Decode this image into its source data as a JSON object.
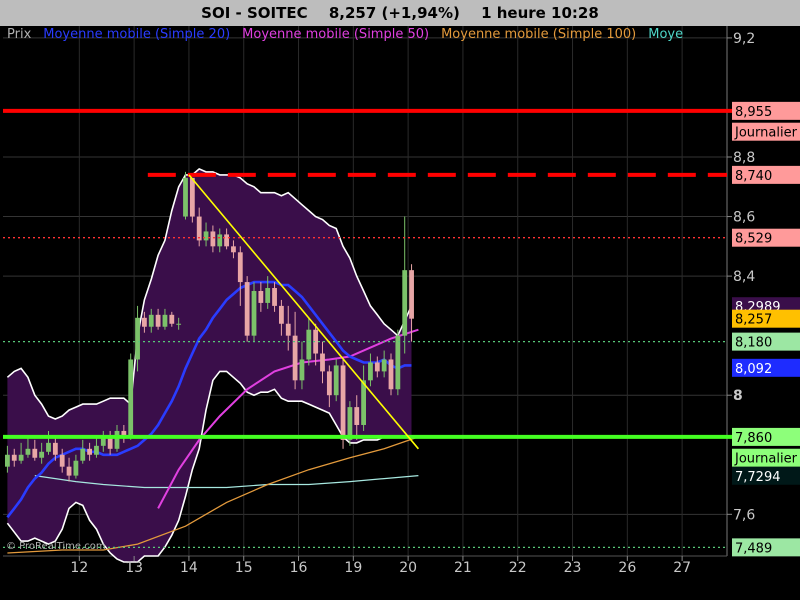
{
  "header": {
    "symbol": "SOI - SOITEC",
    "price_change": "8,257 (+1,94%)",
    "period_time": "1 heure  10:28"
  },
  "legend": [
    {
      "label": "Prix",
      "color": "#b0b0b0"
    },
    {
      "label": "Moyenne mobile (Simple 20)",
      "color": "#2a3cff"
    },
    {
      "label": "Moyenne mobile (Simple 50)",
      "color": "#e040e0"
    },
    {
      "label": "Moyenne mobile (Simple 100)",
      "color": "#e39a3c"
    },
    {
      "label": "Moye",
      "color": "#4fd6c8"
    }
  ],
  "watermark": "© ProRealTime.com",
  "colors": {
    "background": "#000000",
    "bollinger_fill": "#3a0e4a",
    "bollinger_border": "#ffffff",
    "candle_up": "#7cc26a",
    "candle_down": "#e8a6a6",
    "ma20": "#2a3cff",
    "ma50": "#e040e0",
    "ma100": "#e39a3c",
    "ma200": "#a7e8e0",
    "trendline": "#ffff00",
    "resistance": "#ff0000",
    "support": "#44ff22"
  },
  "chart_data": {
    "type": "candlestick",
    "x_tick_labels": [
      "12",
      "13",
      "14",
      "15",
      "16",
      "19",
      "20",
      "21",
      "22",
      "23",
      "26",
      "27"
    ],
    "y_tick_labels": [
      "7,6",
      "8",
      "8,4",
      "8,6",
      "8,8",
      "9,2"
    ],
    "ylim": [
      7.46,
      9.24
    ],
    "price_tags": [
      {
        "text": "8,955",
        "value": 8.955,
        "bg": "#ff9a9a",
        "fg": "#000000"
      },
      {
        "text": "Journalier",
        "value": 8.885,
        "bg": "#ff9a9a",
        "fg": "#000000"
      },
      {
        "text": "8,740",
        "value": 8.74,
        "bg": "#ff9a9a",
        "fg": "#000000"
      },
      {
        "text": "8,529",
        "value": 8.529,
        "bg": "#ff9a9a",
        "fg": "#000000"
      },
      {
        "text": "8,2989",
        "value": 8.2989,
        "bg": "#3a0e4a",
        "fg": "#ffffff"
      },
      {
        "text": "8,257",
        "value": 8.257,
        "bg": "#ffc000",
        "fg": "#000000"
      },
      {
        "text": "8,180",
        "value": 8.18,
        "bg": "#9ce7a3",
        "fg": "#000000"
      },
      {
        "text": "8,092",
        "value": 8.092,
        "bg": "#1e2cff",
        "fg": "#ffffff"
      },
      {
        "text": "7,860",
        "value": 7.86,
        "bg": "#8dff7a",
        "fg": "#000000"
      },
      {
        "text": "Journalier",
        "value": 7.79,
        "bg": "#8dff7a",
        "fg": "#000000"
      },
      {
        "text": "7,7294",
        "value": 7.7294,
        "bg": "#001818",
        "fg": "#ffffff"
      },
      {
        "text": "7,489",
        "value": 7.489,
        "bg": "#9ce7a3",
        "fg": "#000000"
      }
    ],
    "levels": [
      {
        "value": 8.955,
        "color": "#ff0000",
        "style": "solid",
        "width": 4
      },
      {
        "value": 8.74,
        "color": "#ff0000",
        "style": "dashed-long",
        "width": 4,
        "from_index": 20.5
      },
      {
        "value": 8.529,
        "color": "#ff3333",
        "style": "dotted",
        "width": 1.3
      },
      {
        "value": 8.18,
        "color": "#58c878",
        "style": "dotted",
        "width": 1.3
      },
      {
        "value": 7.86,
        "color": "#44ff22",
        "style": "solid",
        "width": 4
      },
      {
        "value": 7.489,
        "color": "#58c878",
        "style": "dotted",
        "width": 1.3
      }
    ],
    "trendline": {
      "from": [
        26.5,
        8.74
      ],
      "to": [
        60,
        7.82
      ]
    },
    "bollinger_upper": [
      8.06,
      8.08,
      8.09,
      8.06,
      8.0,
      7.97,
      7.93,
      7.92,
      7.93,
      7.95,
      7.96,
      7.97,
      7.97,
      7.97,
      7.98,
      7.99,
      7.99,
      7.99,
      7.97,
      8.2,
      8.32,
      8.39,
      8.47,
      8.52,
      8.62,
      8.7,
      8.74,
      8.74,
      8.76,
      8.75,
      8.75,
      8.74,
      8.74,
      8.74,
      8.73,
      8.71,
      8.7,
      8.68,
      8.68,
      8.68,
      8.67,
      8.68,
      8.66,
      8.64,
      8.62,
      8.6,
      8.59,
      8.57,
      8.56,
      8.5,
      8.46,
      8.4,
      8.35,
      8.3,
      8.27,
      8.24,
      8.22,
      8.2,
      8.25,
      8.3
    ],
    "bollinger_lower": [
      7.57,
      7.54,
      7.51,
      7.51,
      7.52,
      7.51,
      7.5,
      7.51,
      7.55,
      7.62,
      7.64,
      7.63,
      7.58,
      7.55,
      7.5,
      7.47,
      7.45,
      7.44,
      7.44,
      7.44,
      7.46,
      7.46,
      7.46,
      7.49,
      7.53,
      7.58,
      7.66,
      7.75,
      7.82,
      7.95,
      8.05,
      8.08,
      8.08,
      8.06,
      8.04,
      8.01,
      8.0,
      8.01,
      8.01,
      8.02,
      7.99,
      7.98,
      7.98,
      7.98,
      7.97,
      7.96,
      7.95,
      7.94,
      7.9,
      7.86,
      7.84,
      7.84,
      7.85,
      7.85,
      7.85,
      7.86,
      7.86,
      7.86,
      7.86,
      7.86
    ],
    "ma20": [
      7.59,
      7.62,
      7.65,
      7.69,
      7.72,
      7.74,
      7.77,
      7.79,
      7.8,
      7.81,
      7.82,
      7.82,
      7.81,
      7.81,
      7.8,
      7.8,
      7.8,
      7.81,
      7.82,
      7.83,
      7.85,
      7.87,
      7.9,
      7.94,
      7.98,
      8.03,
      8.09,
      8.14,
      8.19,
      8.22,
      8.26,
      8.29,
      8.32,
      8.34,
      8.36,
      8.37,
      8.38,
      8.38,
      8.38,
      8.38,
      8.37,
      8.37,
      8.35,
      8.33,
      8.3,
      8.27,
      8.24,
      8.21,
      8.18,
      8.15,
      8.13,
      8.12,
      8.11,
      8.11,
      8.11,
      8.12,
      8.1,
      8.09,
      8.1,
      8.1
    ],
    "ma50_points": [
      [
        22,
        7.62
      ],
      [
        25,
        7.75
      ],
      [
        28,
        7.85
      ],
      [
        31,
        7.93
      ],
      [
        35,
        8.02
      ],
      [
        39,
        8.08
      ],
      [
        43,
        8.11
      ],
      [
        47,
        8.12
      ],
      [
        50,
        8.13
      ],
      [
        53,
        8.16
      ],
      [
        56,
        8.19
      ],
      [
        60,
        8.22
      ]
    ],
    "ma100_points": [
      [
        0,
        7.47
      ],
      [
        8,
        7.48
      ],
      [
        14,
        7.48
      ],
      [
        19,
        7.5
      ],
      [
        26,
        7.56
      ],
      [
        32,
        7.64
      ],
      [
        38,
        7.7
      ],
      [
        44,
        7.75
      ],
      [
        50,
        7.79
      ],
      [
        55,
        7.82
      ],
      [
        60,
        7.86
      ]
    ],
    "ma200_points": [
      [
        4,
        7.73
      ],
      [
        10,
        7.71
      ],
      [
        14,
        7.7
      ],
      [
        20,
        7.69
      ],
      [
        26,
        7.69
      ],
      [
        32,
        7.69
      ],
      [
        38,
        7.7
      ],
      [
        44,
        7.7
      ],
      [
        50,
        7.71
      ],
      [
        55,
        7.72
      ],
      [
        60,
        7.73
      ]
    ],
    "candles": [
      [
        7.76,
        7.8,
        7.83,
        7.74
      ],
      [
        7.8,
        7.78,
        7.82,
        7.76
      ],
      [
        7.78,
        7.8,
        7.84,
        7.77
      ],
      [
        7.8,
        7.82,
        7.86,
        7.79
      ],
      [
        7.82,
        7.79,
        7.85,
        7.78
      ],
      [
        7.79,
        7.81,
        7.84,
        7.77
      ],
      [
        7.81,
        7.84,
        7.88,
        7.8
      ],
      [
        7.84,
        7.8,
        7.86,
        7.78
      ],
      [
        7.8,
        7.76,
        7.82,
        7.74
      ],
      [
        7.76,
        7.73,
        7.79,
        7.71
      ],
      [
        7.73,
        7.78,
        7.8,
        7.72
      ],
      [
        7.78,
        7.82,
        7.85,
        7.77
      ],
      [
        7.82,
        7.8,
        7.84,
        7.78
      ],
      [
        7.8,
        7.83,
        7.86,
        7.79
      ],
      [
        7.83,
        7.86,
        7.88,
        7.81
      ],
      [
        7.86,
        7.82,
        7.88,
        7.8
      ],
      [
        7.82,
        7.88,
        7.9,
        7.81
      ],
      [
        7.88,
        7.86,
        7.9,
        7.84
      ],
      [
        7.86,
        8.12,
        8.14,
        7.85
      ],
      [
        8.12,
        8.26,
        8.3,
        8.08
      ],
      [
        8.26,
        8.23,
        8.28,
        8.21
      ],
      [
        8.23,
        8.27,
        8.29,
        8.21
      ],
      [
        8.27,
        8.23,
        8.29,
        8.22
      ],
      [
        8.23,
        8.27,
        8.29,
        8.22
      ],
      [
        8.27,
        8.24,
        8.28,
        8.23
      ],
      [
        8.24,
        8.24,
        8.26,
        8.22
      ],
      [
        8.6,
        8.73,
        8.75,
        8.59
      ],
      [
        8.73,
        8.6,
        8.72,
        8.58
      ],
      [
        8.6,
        8.52,
        8.63,
        8.5
      ],
      [
        8.52,
        8.55,
        8.58,
        8.5
      ],
      [
        8.55,
        8.5,
        8.57,
        8.48
      ],
      [
        8.5,
        8.54,
        8.56,
        8.48
      ],
      [
        8.54,
        8.5,
        8.56,
        8.49
      ],
      [
        8.5,
        8.48,
        8.52,
        8.46
      ],
      [
        8.48,
        8.38,
        8.5,
        8.3
      ],
      [
        8.38,
        8.2,
        8.4,
        8.18
      ],
      [
        8.2,
        8.35,
        8.38,
        8.18
      ],
      [
        8.35,
        8.31,
        8.38,
        8.28
      ],
      [
        8.31,
        8.36,
        8.4,
        8.29
      ],
      [
        8.36,
        8.3,
        8.38,
        8.28
      ],
      [
        8.3,
        8.24,
        8.32,
        8.2
      ],
      [
        8.24,
        8.2,
        8.3,
        8.15
      ],
      [
        8.2,
        8.05,
        8.28,
        8.02
      ],
      [
        8.05,
        8.12,
        8.18,
        8.02
      ],
      [
        8.12,
        8.22,
        8.26,
        8.1
      ],
      [
        8.22,
        8.14,
        8.24,
        8.1
      ],
      [
        8.14,
        8.08,
        8.18,
        8.04
      ],
      [
        8.08,
        8.0,
        8.1,
        7.96
      ],
      [
        8.0,
        8.1,
        8.12,
        7.98
      ],
      [
        8.1,
        7.85,
        8.12,
        7.82
      ],
      [
        7.85,
        7.96,
        7.98,
        7.83
      ],
      [
        7.96,
        7.9,
        8.0,
        7.85
      ],
      [
        7.9,
        8.05,
        8.1,
        7.88
      ],
      [
        8.05,
        8.11,
        8.14,
        8.03
      ],
      [
        8.11,
        8.08,
        8.13,
        8.06
      ],
      [
        8.08,
        8.12,
        8.15,
        8.06
      ],
      [
        8.12,
        8.02,
        8.14,
        8.0
      ],
      [
        8.02,
        8.2,
        8.22,
        8.0
      ],
      [
        8.2,
        8.42,
        8.6,
        8.14
      ],
      [
        8.42,
        8.257,
        8.44,
        8.18
      ]
    ]
  }
}
